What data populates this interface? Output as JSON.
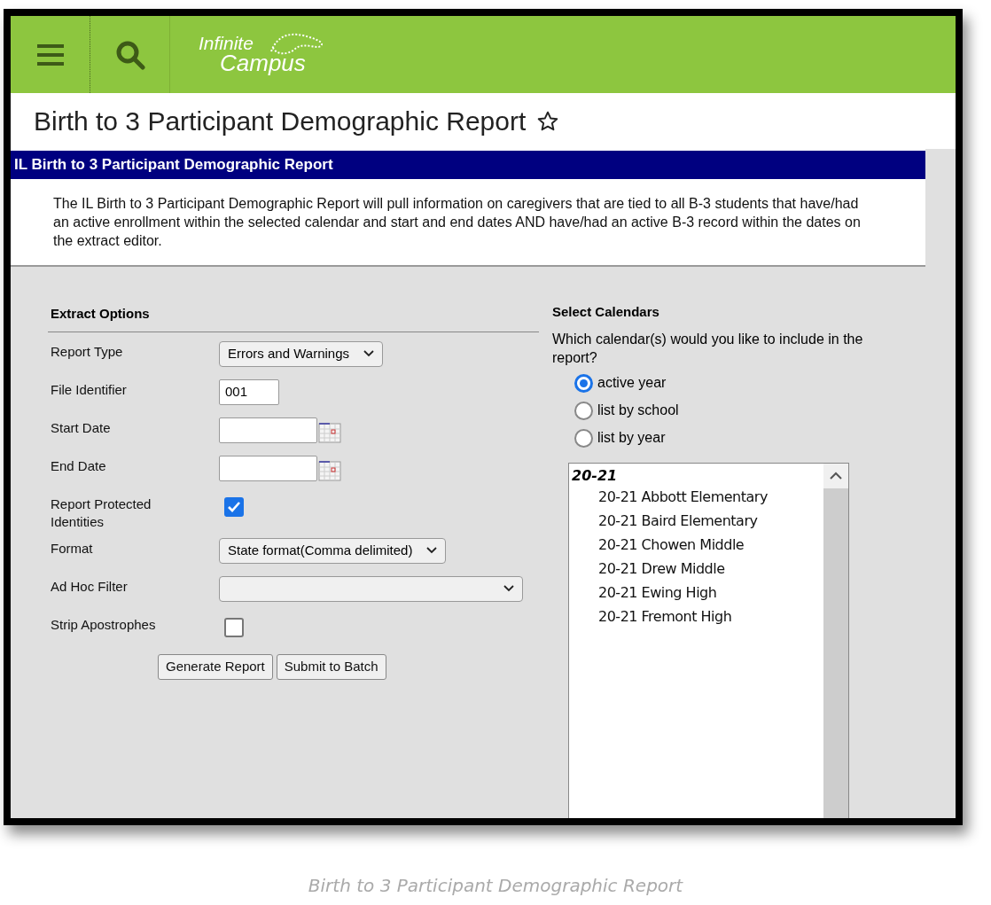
{
  "header": {
    "logo_line_1": "Infinite",
    "logo_line_2": "Campus"
  },
  "page_title": "Birth to 3 Participant Demographic Report",
  "section_title": "IL Birth to 3 Participant Demographic Report",
  "description": "The IL Birth to 3 Participant Demographic Report will pull information on caregivers that are tied to all B-3 students that have/had an active enrollment within the selected calendar and start and end dates AND have/had an active B-3 record within the dates on the extract editor.",
  "extract_options": {
    "title": "Extract Options",
    "fields": [
      {
        "kind": "select",
        "label": "Report Type",
        "value": "Errors and Warnings"
      },
      {
        "kind": "text",
        "label": "File Identifier",
        "value": "001"
      },
      {
        "kind": "date",
        "label": "Start Date"
      },
      {
        "kind": "date",
        "label": "End Date"
      },
      {
        "kind": "checkbox",
        "label": "Report Protected Identities",
        "checked": true
      },
      {
        "kind": "select",
        "label": "Format",
        "value": "State format(Comma delimited)"
      },
      {
        "kind": "wideselect",
        "label": "Ad Hoc Filter"
      },
      {
        "kind": "checkbox",
        "label": "Strip Apostrophes",
        "checked": false
      }
    ],
    "buttons": [
      "Generate Report",
      "Submit to Batch"
    ]
  },
  "calendars": {
    "title": "Select Calendars",
    "question": "Which calendar(s) would you like to include in the report?",
    "options": [
      {
        "label": "active year",
        "selected": true
      },
      {
        "label": "list by school",
        "selected": false
      },
      {
        "label": "list by year",
        "selected": false
      }
    ],
    "group": "20-21",
    "items": [
      "20-21 Abbott Elementary",
      "20-21 Baird Elementary",
      "20-21 Chowen Middle",
      "20-21 Drew Middle",
      "20-21 Ewing High",
      "20-21 Fremont High"
    ]
  },
  "caption": "Birth to 3 Participant Demographic Report"
}
